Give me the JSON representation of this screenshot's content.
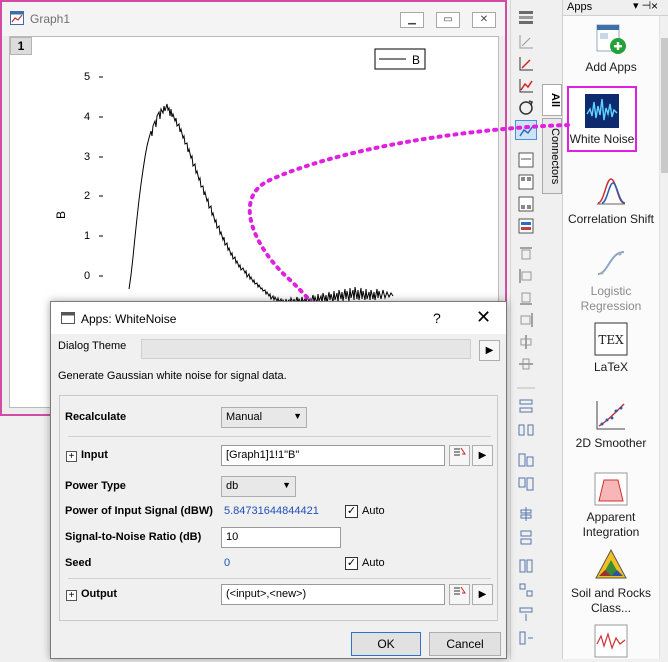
{
  "graph": {
    "title": "Graph1",
    "layer_number": "1",
    "legend_label": "B",
    "y_axis_title": "B",
    "y_ticks": [
      "5",
      "4",
      "3",
      "2",
      "1",
      "0"
    ]
  },
  "apps_panel": {
    "title": "Apps",
    "pin_glyph": "▾ ⊣",
    "close_glyph": "×",
    "tabs": [
      "All",
      "Connectors"
    ],
    "items": [
      {
        "label": "Add Apps",
        "icon": "add-apps-icon"
      },
      {
        "label": "White Noise",
        "icon": "white-noise-icon"
      },
      {
        "label": "Correlation Shift",
        "icon": "correlation-shift-icon"
      },
      {
        "label": "Logistic Regression",
        "icon": "logistic-regression-icon"
      },
      {
        "label": "LaTeX",
        "icon": "latex-icon"
      },
      {
        "label": "2D Smoother",
        "icon": "2d-smoother-icon"
      },
      {
        "label": "Apparent Integration",
        "icon": "apparent-integration-icon"
      },
      {
        "label": "Soil and Rocks Class...",
        "icon": "soil-rocks-icon"
      }
    ]
  },
  "dialog": {
    "title": "Apps: WhiteNoise",
    "help_glyph": "?",
    "close_glyph": "✕",
    "theme_label": "Dialog Theme",
    "description": "Generate Gaussian white noise for signal data.",
    "recalculate_label": "Recalculate",
    "recalculate_value": "Manual",
    "input_label": "Input",
    "input_value": "[Graph1]1!1\"B\"",
    "power_type_label": "Power Type",
    "power_type_value": "db",
    "power_signal_label": "Power of Input Signal (dBW)",
    "power_signal_value": "5.84731644844421",
    "auto_label": "Auto",
    "snr_label": "Signal-to-Noise Ratio (dB)",
    "snr_value": "10",
    "seed_label": "Seed",
    "seed_value": "0",
    "output_label": "Output",
    "output_value": "(<input>,<new>)",
    "ok_label": "OK",
    "cancel_label": "Cancel"
  },
  "colors": {
    "accent": "#e020e0",
    "value_blue": "#1f4fb6",
    "selected_border": "#e020e0"
  }
}
